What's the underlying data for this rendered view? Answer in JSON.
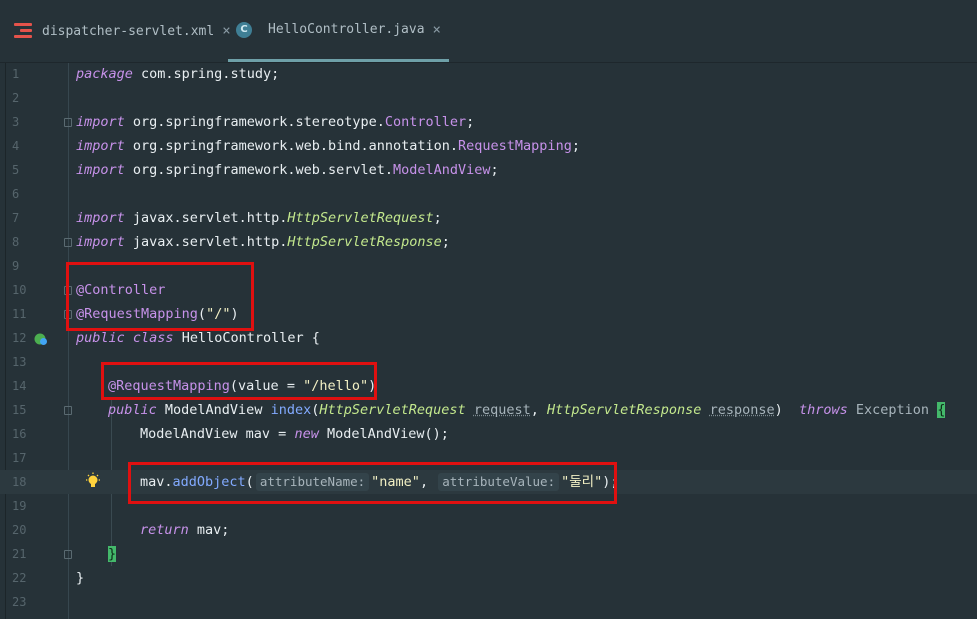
{
  "tabs": [
    {
      "label": "dispatcher-servlet.xml",
      "icon": "xml-file-icon",
      "active": false
    },
    {
      "label": "HelloController.java",
      "icon": "java-class-icon",
      "active": true
    }
  ],
  "close_glyph": "×",
  "class_icon_letter": "C",
  "line_numbers": [
    "1",
    "2",
    "3",
    "4",
    "5",
    "6",
    "7",
    "8",
    "9",
    "10",
    "11",
    "12",
    "13",
    "14",
    "15",
    "16",
    "17",
    "18",
    "19",
    "20",
    "21",
    "22",
    "23"
  ],
  "code": {
    "l1": {
      "kw": "package",
      "rest": " com.spring.study;"
    },
    "imports": {
      "kw": "import",
      "l3_pkg": " org.springframework.stereotype.",
      "l3_cls": "Controller",
      "l3_end": ";",
      "l4_pkg": " org.springframework.web.bind.annotation.",
      "l4_cls": "RequestMapping",
      "l4_end": ";",
      "l5_pkg": " org.springframework.web.servlet.",
      "l5_cls": "ModelAndView",
      "l5_end": ";",
      "l7_pkg": " javax.servlet.http.",
      "l7_cls": "HttpServletRequest",
      "l7_end": ";",
      "l8_pkg": " javax.servlet.http.",
      "l8_cls": "HttpServletResponse",
      "l8_end": ";"
    },
    "l10": "@Controller",
    "l11_ann": "@RequestMapping",
    "l11_open": "(",
    "l11_str": "\"/\"",
    "l11_close": ")",
    "l12_kw1": "public",
    "l12_kw2": "class",
    "l12_rest": " HelloController {",
    "l14_ann": "@RequestMapping",
    "l14_mid": "(value = ",
    "l14_str": "\"/hello\"",
    "l14_close": ")",
    "l15": {
      "kw": "public",
      "type": " ModelAndView ",
      "fn": "index",
      "open": "(",
      "t1": "HttpServletRequest",
      "p1": "request",
      "comma": ", ",
      "t2": "HttpServletResponse",
      "p2": "response",
      "close": ") ",
      "throws": "throws",
      "exc": " Exception ",
      "brace": "{"
    },
    "l16": {
      "a": "ModelAndView mav = ",
      "kw": "new",
      "b": " ModelAndView();"
    },
    "l18": {
      "obj": "mav.",
      "fn": "addObject",
      "open": "(",
      "hint1": "attributeName:",
      "str1": "\"name\"",
      "comma": ", ",
      "hint2": "attributeValue:",
      "str2": "\"둘리\"",
      "close": ");"
    },
    "l20": {
      "kw": "return",
      "rest": " mav;"
    },
    "l21": "}",
    "l22": "}"
  },
  "icons": {
    "bulb": "lightbulb-icon",
    "gutter": "spring-bean-icon"
  },
  "colors": {
    "annotation_box": "#e01010",
    "background": "#263238",
    "keyword": "#c792ea",
    "string": "#f2f0c4"
  }
}
